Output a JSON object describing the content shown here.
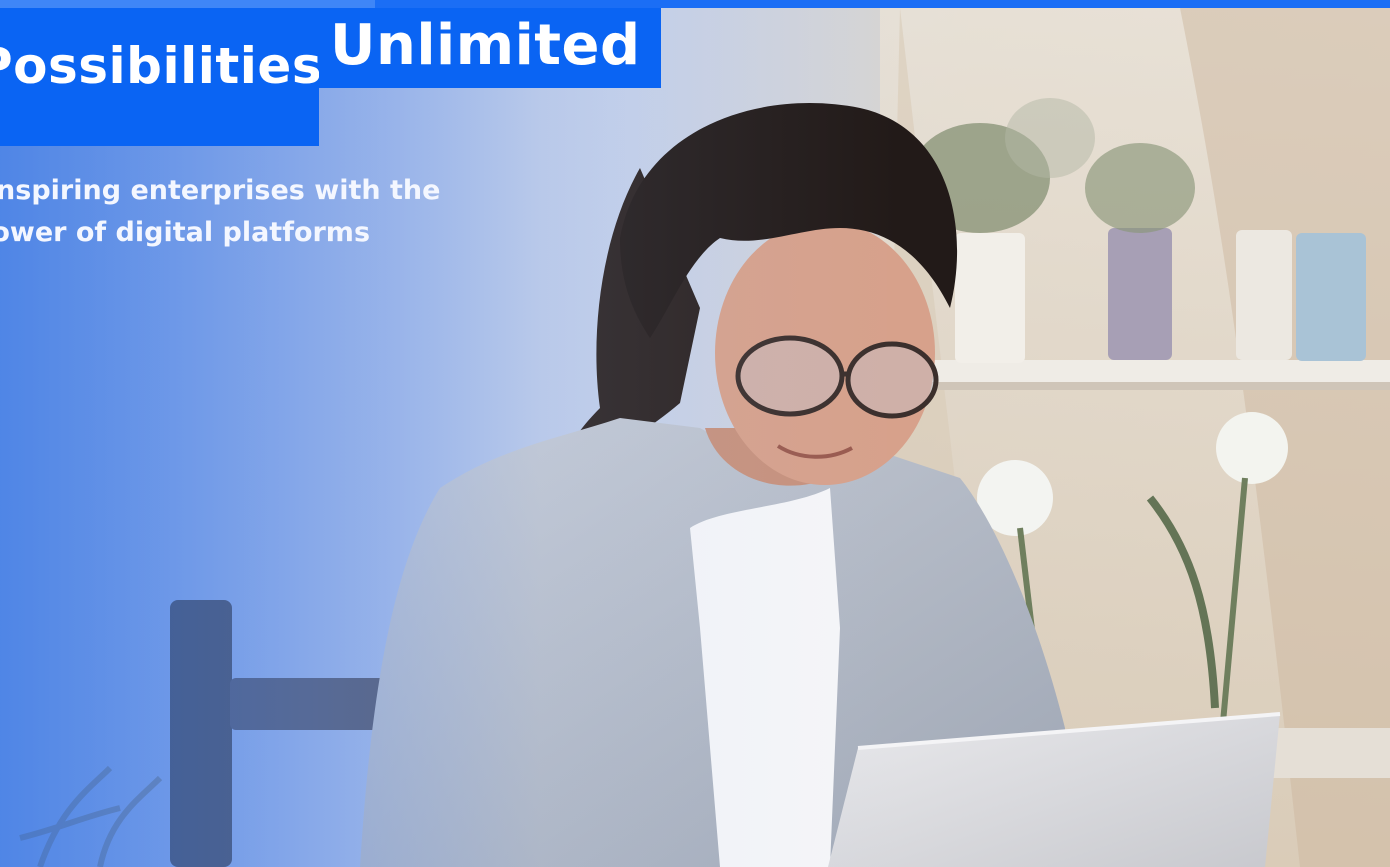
{
  "hero": {
    "title_left": "Possibilities",
    "title_right": "Unlimited",
    "subtitle_line1": "Inspiring enterprises with the",
    "subtitle_line2": "power of digital platforms"
  },
  "colors": {
    "accent_blue": "#0a64f3",
    "top_bar_blue": "#1b6ef5",
    "text_white": "#ffffff"
  }
}
